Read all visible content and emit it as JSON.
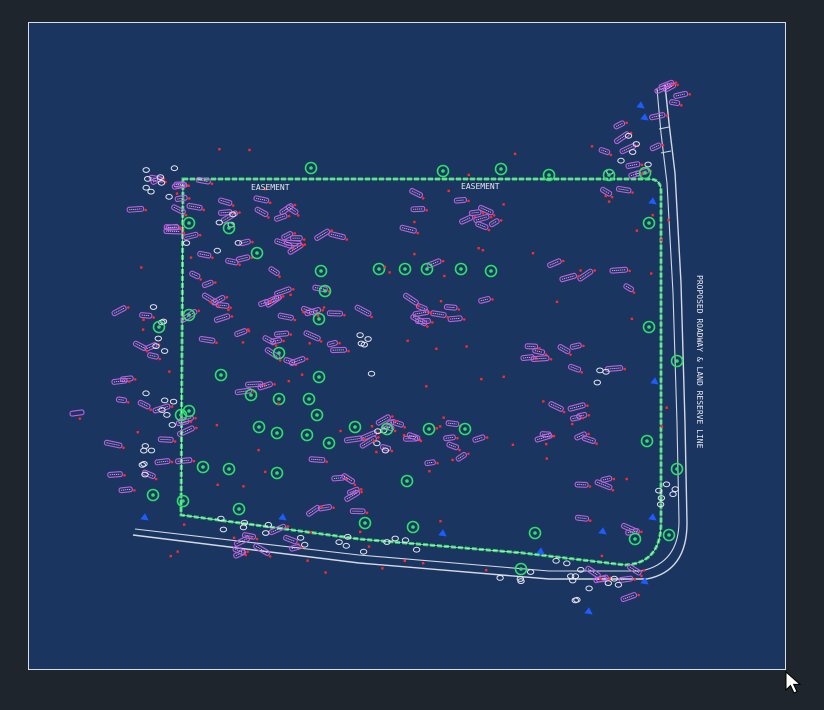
{
  "app": {
    "background": "#1f252c"
  },
  "canvas": {
    "background": "#1a355f",
    "frame_color": "#d8dde6",
    "boundary_color": "#34d86a",
    "road_color": "#d4d8e4",
    "label_color": "#c060e0",
    "marker_color": "#ff2a2a",
    "bush_color": "#2ee06a",
    "misc_color": "#1f5cff",
    "shrub_outline_color": "#e6e6f0"
  },
  "labels": {
    "top_label": "EASEMENT",
    "top_left_label": "EASEMENT",
    "street_label": "PROPOSED ROADWAY & LAND RESERVE LINE"
  },
  "cursor": {
    "icon": "arrow-cursor-icon"
  }
}
